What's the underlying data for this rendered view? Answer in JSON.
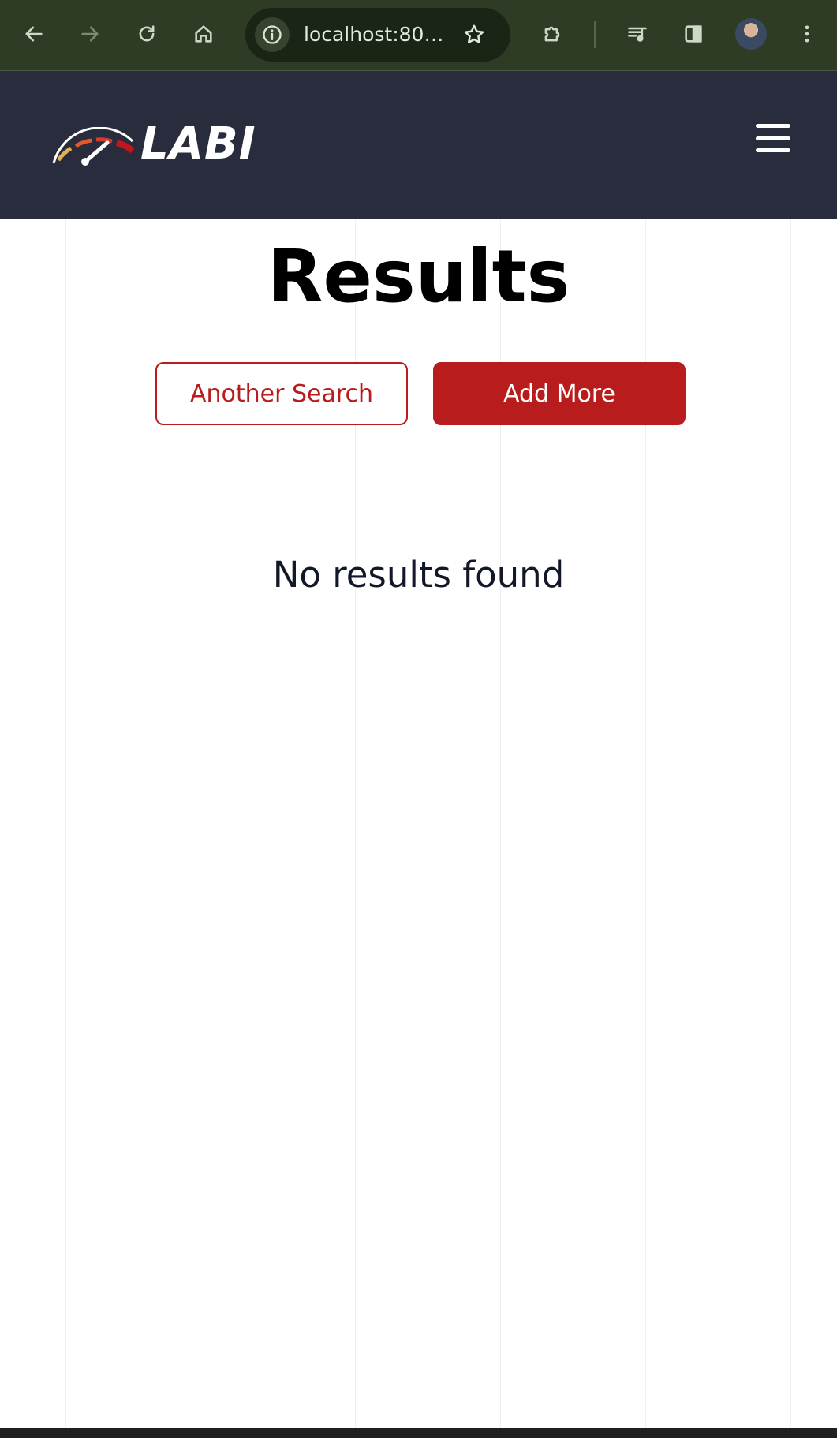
{
  "browser": {
    "url": "localhost:80…",
    "icons": [
      "back-arrow-icon",
      "forward-arrow-icon",
      "reload-icon",
      "home-icon",
      "site-info-icon",
      "bookmark-star-icon",
      "extensions-puzzle-icon",
      "media-queue-icon",
      "side-panel-icon",
      "profile-avatar",
      "more-menu-icon"
    ],
    "theme_color": "#2e3c26"
  },
  "header": {
    "brand": "LABI",
    "background": "#292c3d",
    "menu_icon": "hamburger-menu-icon"
  },
  "main": {
    "title": "Results",
    "another_search_label": "Another Search",
    "add_more_label": "Add More",
    "empty_message": "No results found",
    "accent_color": "#b91c1c"
  }
}
